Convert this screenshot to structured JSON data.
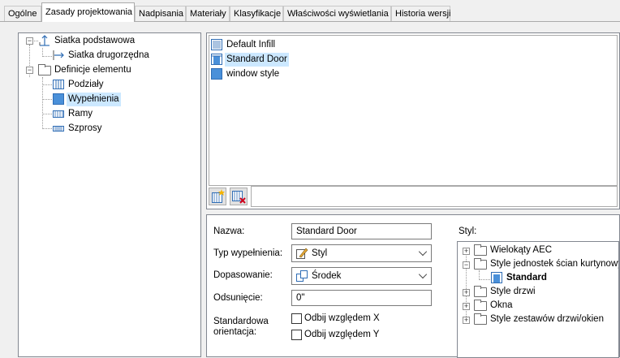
{
  "tabs": [
    {
      "label": "Ogólne"
    },
    {
      "label": "Zasady projektowania"
    },
    {
      "label": "Nadpisania"
    },
    {
      "label": "Materiały"
    },
    {
      "label": "Klasyfikacje"
    },
    {
      "label": "Właściwości wyświetlania"
    },
    {
      "label": "Historia wersji"
    }
  ],
  "active_tab": "Zasady projektowania",
  "tree": {
    "grid_primary": "Siatka podstawowa",
    "grid_secondary": "Siatka drugorzędna",
    "element_definitions": "Definicje elementu",
    "divisions": "Podziały",
    "infills": "Wypełnienia",
    "frames": "Ramy",
    "mullions": "Szprosy",
    "selected": "Wypełnienia"
  },
  "infill_list": {
    "items": [
      "Default Infill",
      "Standard Door",
      "window style"
    ],
    "selected": "Standard Door"
  },
  "form": {
    "name_label": "Nazwa:",
    "name_value": "Standard Door",
    "infill_type_label": "Typ wypełnienia:",
    "infill_type_value": "Styl",
    "alignment_label": "Dopasowanie:",
    "alignment_value": "Środek",
    "offset_label": "Odsunięcie:",
    "offset_value": "0\"",
    "orientation_label_1": "Standardowa",
    "orientation_label_2": "orientacja:",
    "flip_x_label": "Odbij względem X",
    "flip_y_label": "Odbij względem Y",
    "flip_x_checked": false,
    "flip_y_checked": false
  },
  "style_tree": {
    "label": "Styl:",
    "items": [
      {
        "label": "Wielokąty AEC"
      },
      {
        "label": "Style jednostek ścian kurtynowych"
      },
      {
        "label": "Standard"
      },
      {
        "label": "Style drzwi"
      },
      {
        "label": "Okna"
      },
      {
        "label": "Style zestawów drzwi/okien"
      }
    ],
    "selected": "Standard"
  },
  "icons": [
    "folder-icon",
    "grid-icon",
    "infill-icon",
    "frame-icon",
    "add-icon",
    "delete-icon",
    "style-brush-icon",
    "alignment-icon"
  ],
  "colors": {
    "selection": "#cce8ff",
    "border": "#828790",
    "accent_blue": "#2f6db5"
  }
}
